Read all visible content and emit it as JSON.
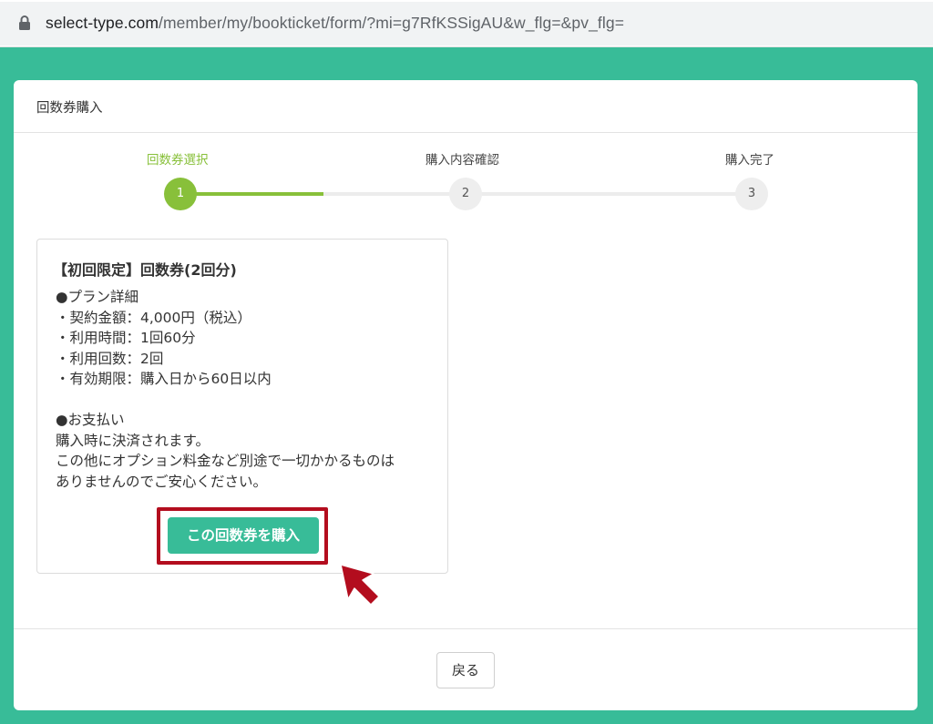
{
  "browser": {
    "url_host": "select-type.com",
    "url_path": "/member/my/bookticket/form/?mi=g7RfKSSigAU&w_flg=&pv_flg="
  },
  "card": {
    "title": "回数券購入"
  },
  "steps": [
    {
      "label": "回数券選択",
      "number": "1"
    },
    {
      "label": "購入内容確認",
      "number": "2"
    },
    {
      "label": "購入完了",
      "number": "3"
    }
  ],
  "steps_progress": 0.5,
  "ticket": {
    "title": "【初回限定】回数券(2回分)",
    "lines": [
      "●プラン詳細",
      "・契約金額：4,000円（税込）",
      "・利用時間：1回60分",
      "・利用回数：2回",
      "・有効期限：購入日から60日以内",
      "",
      "●お支払い",
      "購入時に決済されます。",
      "この他にオプション料金など別途で一切かかるものは",
      "ありませんのでご安心ください。"
    ],
    "buy_label": "この回数券を購入"
  },
  "footer": {
    "back_label": "戻る"
  },
  "colors": {
    "brand": "#38bc98",
    "step_active": "#88c03a",
    "highlight": "#b30d1e"
  }
}
